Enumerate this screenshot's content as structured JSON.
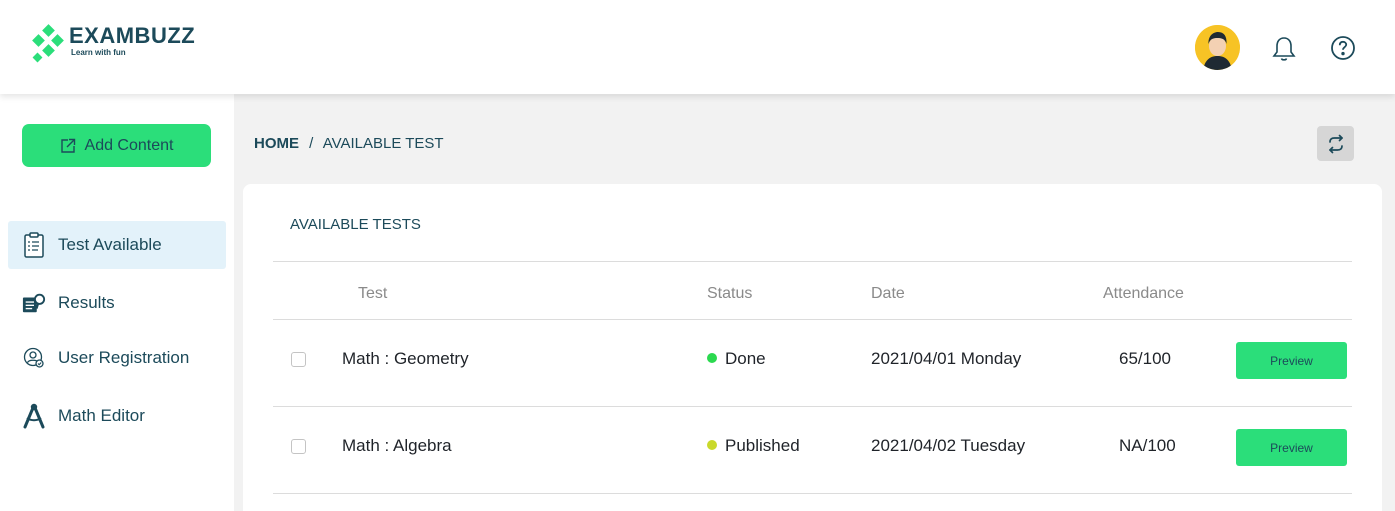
{
  "brand": {
    "name": "EXAMBUZZ",
    "tagline": "Learn with fun"
  },
  "header": {
    "avatar": "user-avatar",
    "bell": "bell-icon",
    "help": "help-icon"
  },
  "sidebar": {
    "add_button": "Add Content",
    "items": [
      {
        "label": "Test Available",
        "icon": "clipboard-icon",
        "active": true
      },
      {
        "label": "Results",
        "icon": "results-icon",
        "active": false
      },
      {
        "label": "User Registration",
        "icon": "user-registration-icon",
        "active": false
      },
      {
        "label": "Math Editor",
        "icon": "compass-icon",
        "active": false
      }
    ]
  },
  "breadcrumb": {
    "home": "HOME",
    "separator": "/",
    "current": "AVAILABLE TEST"
  },
  "card": {
    "title": "AVAILABLE TESTS",
    "columns": [
      "Test",
      "Status",
      "Date",
      "Attendance"
    ],
    "rows": [
      {
        "test": "Math : Geometry",
        "status": "Done",
        "status_color": "#2bd94f",
        "date": "2021/04/01 Monday",
        "attendance": "65/100",
        "action": "Preview"
      },
      {
        "test": "Math : Algebra",
        "status": "Published",
        "status_color": "#c9d92b",
        "date": "2021/04/02 Tuesday",
        "attendance": "NA/100",
        "action": "Preview"
      }
    ]
  },
  "colors": {
    "accent": "#2bde7a",
    "text_dark": "#1c4a5a",
    "active_bg": "#e3f2fa"
  }
}
